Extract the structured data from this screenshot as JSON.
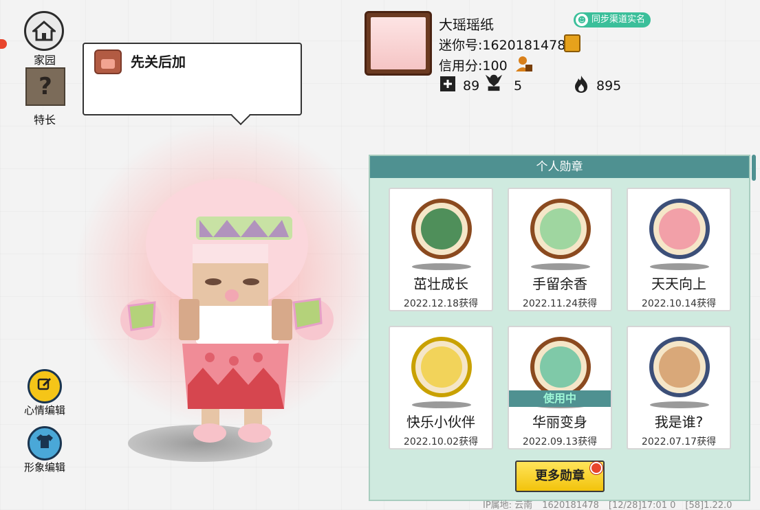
{
  "left_nav": {
    "home_label": "家园",
    "specialty_label": "特长",
    "specialty_icon_glyph": "?",
    "mood_edit_label": "心情编辑",
    "avatar_edit_label": "形象编辑"
  },
  "bubble": {
    "text": "先关后加"
  },
  "profile": {
    "name": "大瑶瑶纸",
    "verify_badge": "同步渠道实名",
    "mini_id": "迷你号:1620181478",
    "credit": "信用分:100",
    "stats": [
      {
        "icon": "plus-icon",
        "value": "89"
      },
      {
        "icon": "fans-icon",
        "value": "5"
      },
      {
        "icon": "fire-icon",
        "value": "895"
      }
    ]
  },
  "medals": {
    "header": "个人勋章",
    "items": [
      {
        "title": "茁壮成长",
        "date": "2022.12.18获得",
        "ring": "#8b4a1f",
        "fill": "#4f8f5a",
        "in_use": false
      },
      {
        "title": "手留余香",
        "date": "2022.11.24获得",
        "ring": "#8b4a1f",
        "fill": "#9fd6a0",
        "in_use": false
      },
      {
        "title": "天天向上",
        "date": "2022.10.14获得",
        "ring": "#3c4f78",
        "fill": "#f2a0a8",
        "in_use": false
      },
      {
        "title": "快乐小伙伴",
        "date": "2022.10.02获得",
        "ring": "#c9a100",
        "fill": "#f2d35a",
        "in_use": false
      },
      {
        "title": "华丽变身",
        "date": "2022.09.13获得",
        "ring": "#8b4a1f",
        "fill": "#7fc9a8",
        "in_use": true,
        "in_use_label": "使用中"
      },
      {
        "title": "我是谁?",
        "date": "2022.07.17获得",
        "ring": "#3c4f78",
        "fill": "#d9a879",
        "in_use": false
      }
    ],
    "more_button": "更多勋章"
  },
  "footer": {
    "ip": "IP属地: 云南",
    "uid": "1620181478",
    "time": "[12/28]17:01 0",
    "version": "[58]1.22.0"
  },
  "colors": {
    "accent_teal": "#4f9191",
    "panel_bg": "#cfeadf",
    "button_yellow": "#f2c30c",
    "badge_green": "#3bbf9a"
  }
}
